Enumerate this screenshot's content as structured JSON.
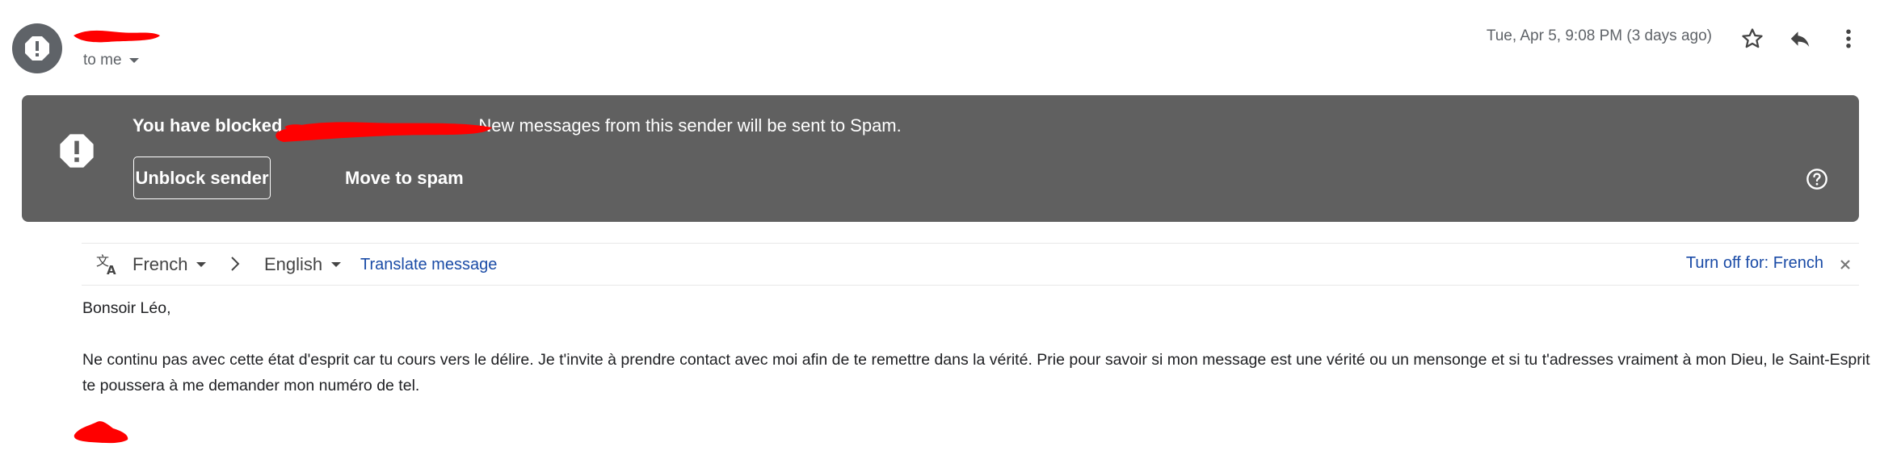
{
  "header": {
    "recipient": "to me",
    "date": "Tue, Apr 5, 9:08 PM (3 days ago)",
    "icons": [
      "alert-icon",
      "caret-down-icon",
      "star-icon",
      "reply-icon",
      "more-vert-icon"
    ]
  },
  "banner": {
    "blocked_prefix": "You have blocked",
    "message_suffix": "New messages from this sender will be sent to Spam.",
    "unblock_label": "Unblock sender",
    "move_label": "Move to spam",
    "background": "#606060"
  },
  "translate": {
    "source_lang": "French",
    "target_lang": "English",
    "translate_label": "Translate message",
    "turn_off_label": "Turn off for: French",
    "link_color": "#1a4ba6"
  },
  "body": {
    "greeting": "Bonsoir Léo,",
    "paragraph": "Ne continu pas avec cette état d'esprit car tu cours vers le délire. Je t'invite à prendre contact avec moi afin de te remettre dans la vérité. Prie pour savoir si mon message est une vérité ou un mensonge et si tu t'adresses vraiment à mon Dieu, le Saint-Esprit te poussera à me demander mon numéro de tel."
  }
}
